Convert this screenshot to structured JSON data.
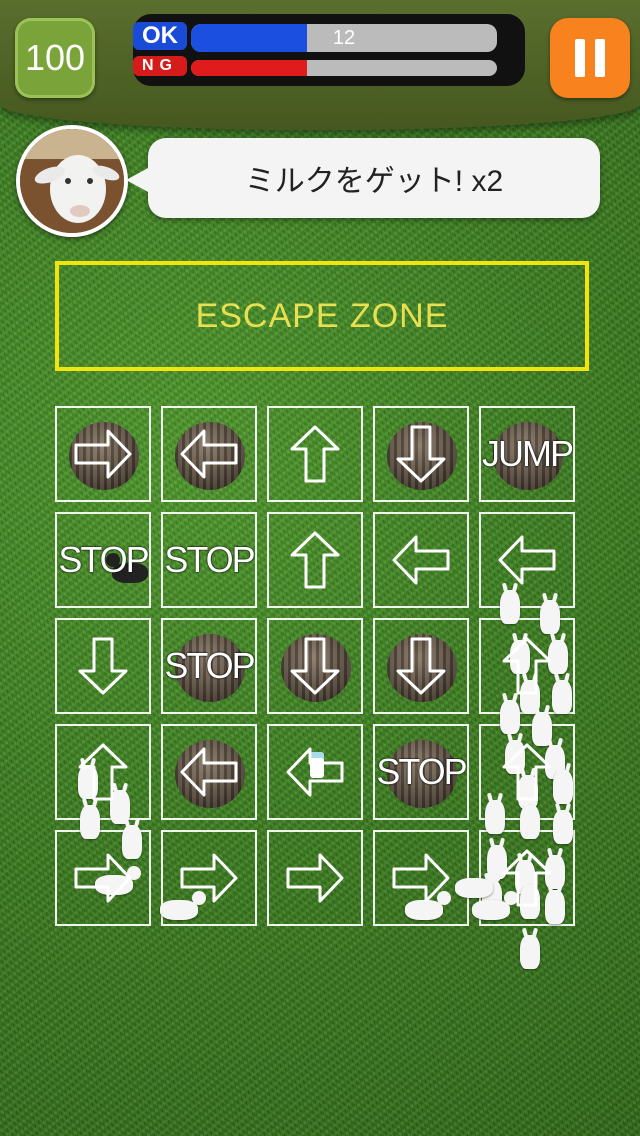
{
  "hud": {
    "score": "100",
    "ok_label": "OK",
    "ng_label": "NG",
    "ok_count": "12",
    "ok_fraction": 0.38,
    "ng_fraction": 0.38,
    "pause_icon": "pause-icon"
  },
  "message": {
    "text": "ミルクをゲット! x2",
    "avatar_icon": "goat-portrait"
  },
  "escape_zone": {
    "label": "ESCAPE ZONE"
  },
  "grid": {
    "rows": [
      [
        {
          "kind": "arrow-right",
          "hole": true
        },
        {
          "kind": "arrow-left",
          "hole": true
        },
        {
          "kind": "arrow-up",
          "hole": false
        },
        {
          "kind": "arrow-down",
          "hole": true
        },
        {
          "kind": "text",
          "text": "JUMP",
          "hole": true
        }
      ],
      [
        {
          "kind": "text",
          "text": "STOP",
          "hole": false
        },
        {
          "kind": "text",
          "text": "STOP",
          "hole": false
        },
        {
          "kind": "arrow-up",
          "hole": false
        },
        {
          "kind": "arrow-left",
          "hole": false
        },
        {
          "kind": "arrow-left",
          "hole": false
        }
      ],
      [
        {
          "kind": "arrow-down",
          "hole": false
        },
        {
          "kind": "text",
          "text": "STOP",
          "hole": true
        },
        {
          "kind": "arrow-down",
          "hole": true
        },
        {
          "kind": "arrow-down",
          "hole": true
        },
        {
          "kind": "arrow-up",
          "hole": false
        }
      ],
      [
        {
          "kind": "arrow-up",
          "hole": false
        },
        {
          "kind": "arrow-left",
          "hole": true
        },
        {
          "kind": "arrow-left",
          "hole": false
        },
        {
          "kind": "text",
          "text": "STOP",
          "hole": true
        },
        {
          "kind": "arrow-up",
          "hole": false
        }
      ],
      [
        {
          "kind": "arrow-right",
          "hole": false
        },
        {
          "kind": "arrow-right",
          "hole": false
        },
        {
          "kind": "arrow-right",
          "hole": false
        },
        {
          "kind": "arrow-right",
          "hole": false
        },
        {
          "kind": "arrow-up",
          "hole": false
        }
      ]
    ]
  }
}
